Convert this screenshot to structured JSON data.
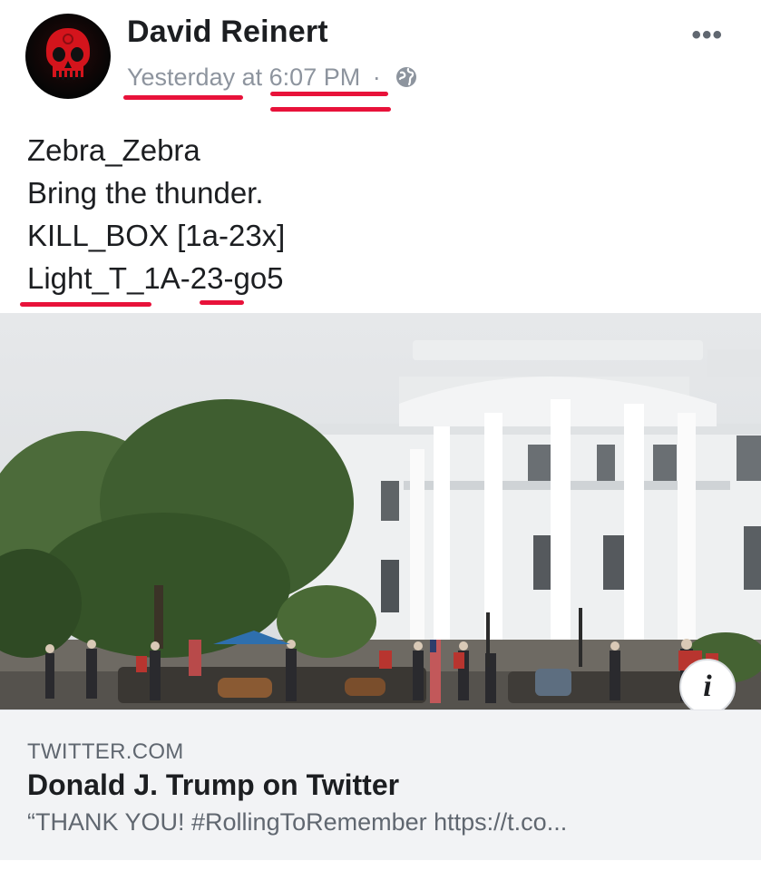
{
  "post": {
    "author": "David Reinert",
    "time_day": "Yesterday",
    "time_connector": "at",
    "time_clock": "6:07 PM",
    "separator": "·",
    "privacy_icon": "globe-icon",
    "more_icon": "more-options-icon",
    "more_label": "•••",
    "text_lines": [
      "Zebra_Zebra",
      "Bring the thunder.",
      "KILL_BOX [1a-23x]",
      "Light_T_1A-23-go5"
    ]
  },
  "link_preview": {
    "domain": "TWITTER.COM",
    "title": "Donald J. Trump on Twitter",
    "description": "“THANK YOU! #RollingToRemember https://t.co...",
    "info_label": "i"
  },
  "colors": {
    "annotation_red": "#e8123a",
    "avatar_skull": "#d4141c",
    "meta_gray": "#8d949e",
    "card_background": "#f2f3f5"
  }
}
